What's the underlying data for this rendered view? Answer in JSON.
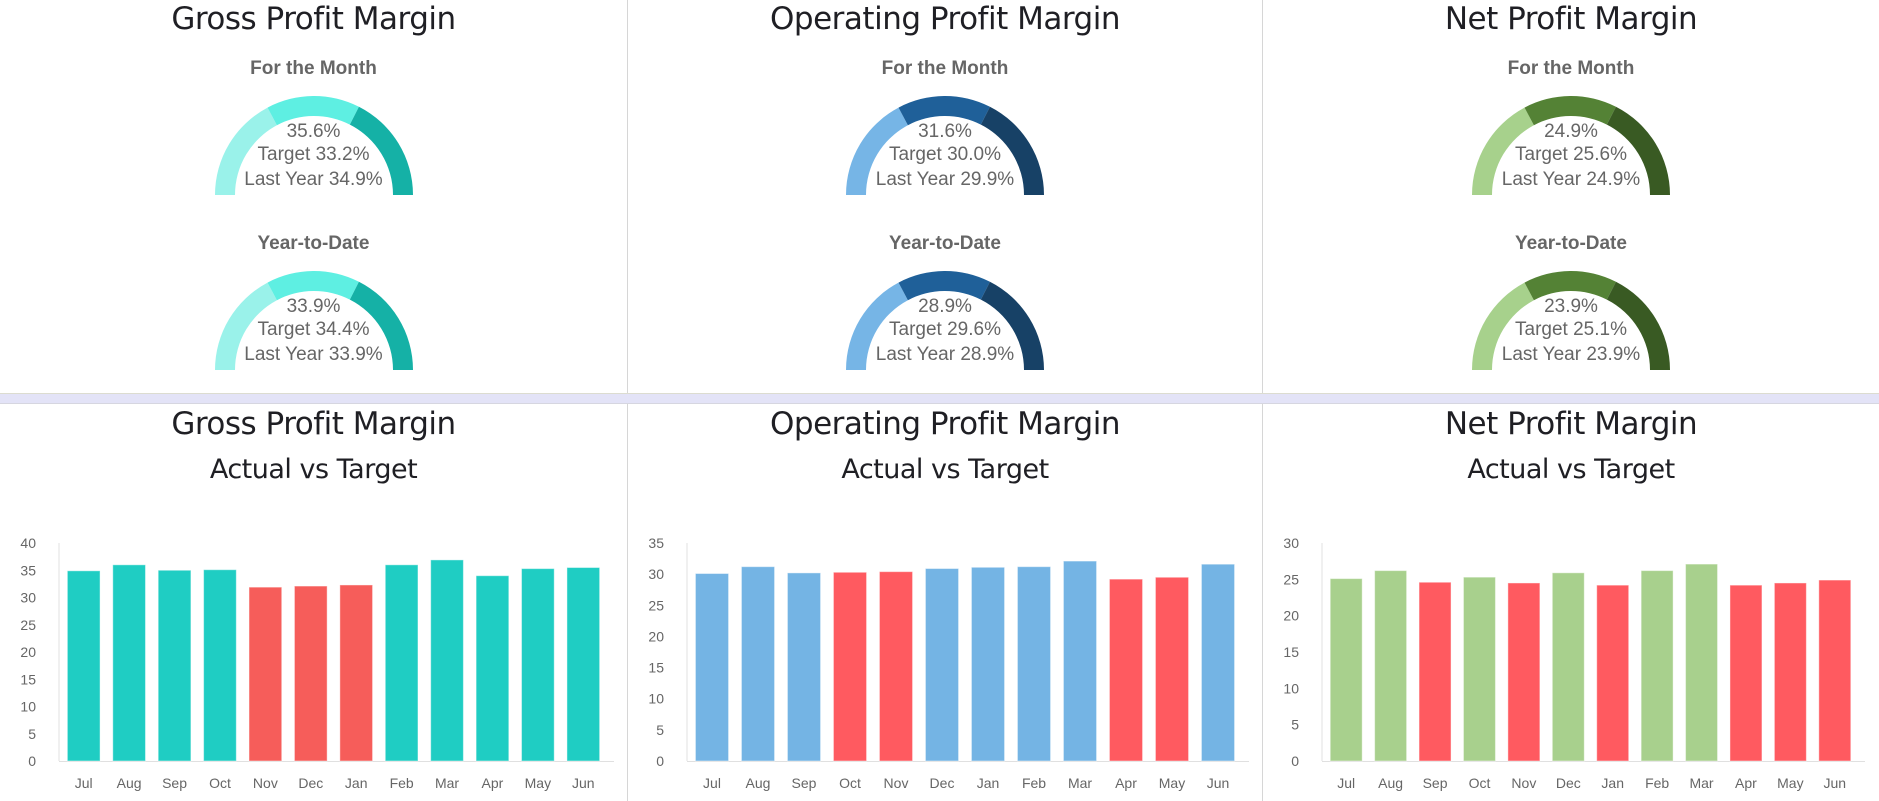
{
  "colors": {
    "miss": "#f65d5a",
    "miss_alt": "#ff5a60",
    "axis": "#e0e0e0",
    "separator": "#e3e3f7"
  },
  "panels": [
    {
      "title": "Gross Profit Margin",
      "gauge_colors": [
        "#9af2ea",
        "#5eefe2",
        "#15b1a6"
      ],
      "gauges": [
        {
          "label": "For the Month",
          "value": "35.6%",
          "target": "Target 33.2%",
          "last_year": "Last Year 34.9%"
        },
        {
          "label": "Year-to-Date",
          "value": "33.9%",
          "target": "Target 34.4%",
          "last_year": "Last Year 33.9%"
        }
      ]
    },
    {
      "title": "Operating Profit Margin",
      "gauge_colors": [
        "#76b5e6",
        "#1f6099",
        "#174166"
      ],
      "gauges": [
        {
          "label": "For the Month",
          "value": "31.6%",
          "target": "Target 30.0%",
          "last_year": "Last Year 29.9%"
        },
        {
          "label": "Year-to-Date",
          "value": "28.9%",
          "target": "Target 29.6%",
          "last_year": "Last Year 28.9%"
        }
      ]
    },
    {
      "title": "Net Profit Margin",
      "gauge_colors": [
        "#a7d18c",
        "#548235",
        "#395a23"
      ],
      "gauges": [
        {
          "label": "For the Month",
          "value": "24.9%",
          "target": "Target 25.6%",
          "last_year": "Last Year 24.9%"
        },
        {
          "label": "Year-to-Date",
          "value": "23.9%",
          "target": "Target 25.1%",
          "last_year": "Last Year 23.9%"
        }
      ]
    }
  ],
  "chart_data": [
    {
      "type": "bar",
      "title": "Gross Profit Margin",
      "subtitle": "Actual vs Target",
      "xlabel": "",
      "ylabel": "",
      "categories": [
        "Jul",
        "Aug",
        "Sep",
        "Oct",
        "Nov",
        "Dec",
        "Jan",
        "Feb",
        "Mar",
        "Apr",
        "May",
        "Jun"
      ],
      "values": [
        34.9,
        36.0,
        35.0,
        35.1,
        31.9,
        32.1,
        32.3,
        36.0,
        36.9,
        34.0,
        35.3,
        35.5
      ],
      "below_target": [
        false,
        false,
        false,
        false,
        true,
        true,
        true,
        false,
        false,
        false,
        false,
        false
      ],
      "yticks": [
        0,
        5,
        10,
        15,
        20,
        25,
        30,
        35,
        40
      ],
      "ylim": [
        0,
        40
      ],
      "grid": false,
      "legend": "none",
      "bar_color": "#1fcdc3",
      "miss_color": "#f65d5a"
    },
    {
      "type": "bar",
      "title": "Operating Profit Margin",
      "subtitle": "Actual vs Target",
      "xlabel": "",
      "ylabel": "",
      "categories": [
        "Jul",
        "Aug",
        "Sep",
        "Oct",
        "Nov",
        "Dec",
        "Jan",
        "Feb",
        "Mar",
        "Apr",
        "May",
        "Jun"
      ],
      "values": [
        30.1,
        31.2,
        30.2,
        30.3,
        30.4,
        30.9,
        31.1,
        31.2,
        32.1,
        29.2,
        29.5,
        31.6
      ],
      "below_target": [
        false,
        false,
        false,
        true,
        true,
        false,
        false,
        false,
        false,
        true,
        true,
        false
      ],
      "yticks": [
        0,
        5,
        10,
        15,
        20,
        25,
        30,
        35
      ],
      "ylim": [
        0,
        35
      ],
      "grid": false,
      "legend": "none",
      "bar_color": "#74b4e4",
      "miss_color": "#ff5a60"
    },
    {
      "type": "bar",
      "title": "Net Profit Margin",
      "subtitle": "Actual vs Target",
      "xlabel": "",
      "ylabel": "",
      "categories": [
        "Jul",
        "Aug",
        "Sep",
        "Oct",
        "Nov",
        "Dec",
        "Jan",
        "Feb",
        "Mar",
        "Apr",
        "May",
        "Jun"
      ],
      "values": [
        25.1,
        26.2,
        24.6,
        25.3,
        24.5,
        25.9,
        24.2,
        26.2,
        27.1,
        24.2,
        24.5,
        24.9
      ],
      "below_target": [
        false,
        false,
        true,
        false,
        true,
        false,
        true,
        false,
        false,
        true,
        true,
        true
      ],
      "yticks": [
        0,
        5,
        10,
        15,
        20,
        25,
        30
      ],
      "ylim": [
        0,
        30
      ],
      "grid": false,
      "legend": "none",
      "bar_color": "#a8d08d",
      "miss_color": "#ff5a60"
    }
  ]
}
